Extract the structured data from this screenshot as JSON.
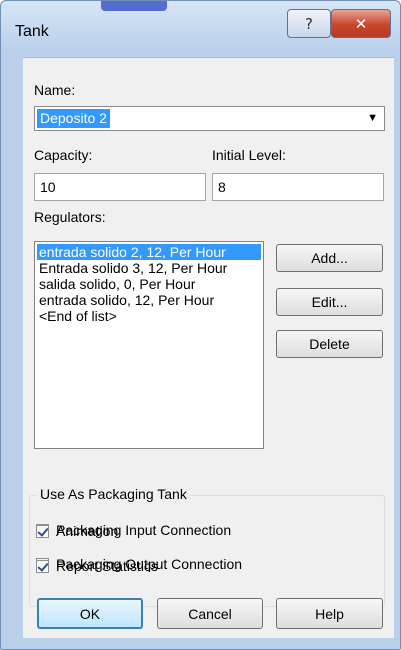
{
  "window": {
    "title": "Tank",
    "help_glyph": "?",
    "close_glyph": "✕"
  },
  "form": {
    "name_label": "Name:",
    "name_value": "Deposito 2",
    "capacity_label": "Capacity:",
    "capacity_value": "10",
    "initial_level_label": "Initial Level:",
    "initial_level_value": "8",
    "regulators_label": "Regulators:"
  },
  "regulators": {
    "items": [
      "entrada solido 2, 12, Per Hour",
      "Entrada solido 3, 12, Per Hour",
      "salida solido, 0, Per Hour",
      "entrada solido, 12, Per Hour",
      "<End of list>"
    ],
    "selected_index": 0
  },
  "side_buttons": {
    "add": "Add...",
    "edit": "Edit...",
    "delete": "Delete"
  },
  "packaging": {
    "group_title": "Use As Packaging Tank",
    "input_connection": {
      "label": "Packaging Input Connection",
      "checked": false
    },
    "output_connection": {
      "label": "Packaging Output Connection",
      "checked": false
    }
  },
  "options": {
    "animation": {
      "label": "Animation",
      "checked": true
    },
    "report_statistics": {
      "label": "Report Statistics",
      "checked": true
    }
  },
  "footer": {
    "ok": "OK",
    "cancel": "Cancel",
    "help": "Help"
  }
}
